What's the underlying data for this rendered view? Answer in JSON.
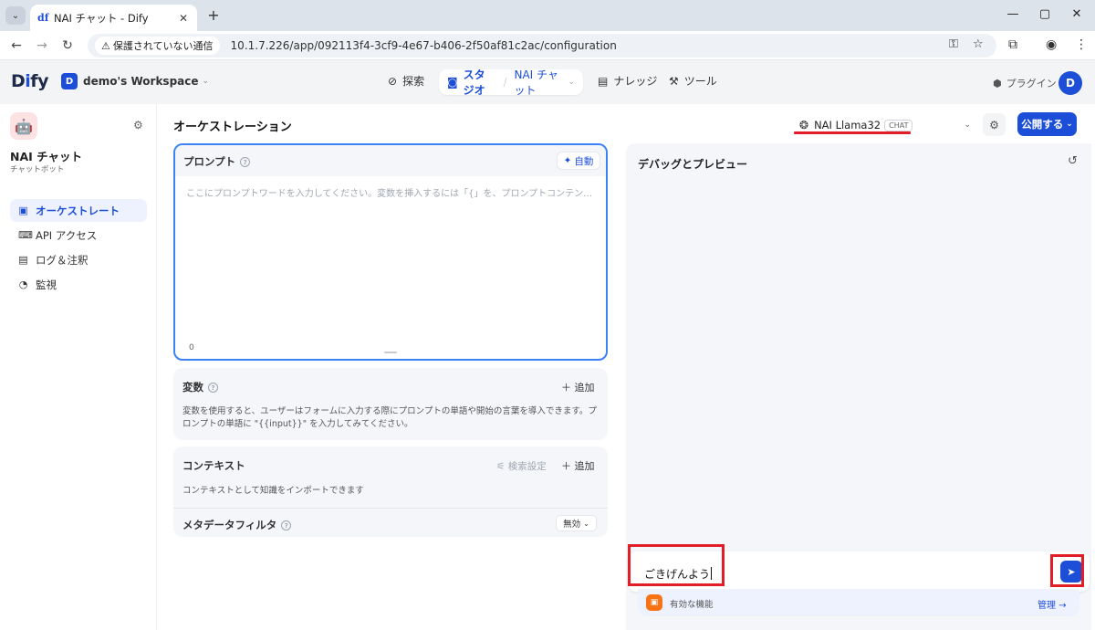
{
  "browser": {
    "tab_title": "NAI チャット - Dify",
    "tab_favicon": "df",
    "new_tab": "+",
    "security_label": "保護されていない通信",
    "url": "10.1.7.226/app/092113f4-3cf9-4e67-b406-2f50af81c2ac/configuration"
  },
  "header": {
    "logo_prefix": "D",
    "logo_i": "i",
    "logo_suffix": "fy",
    "workspace_initial": "D",
    "workspace_name": "demo's Workspace",
    "nav": {
      "explore": "探索",
      "studio": "スタジオ",
      "current_app": "NAI チャット",
      "knowledge": "ナレッジ",
      "tools": "ツール"
    },
    "plugins": "プラグイン",
    "user_initial": "D"
  },
  "sidebar": {
    "app_name": "NAI チャット",
    "app_type": "チャットボット",
    "items": [
      {
        "label": "オーケストレート"
      },
      {
        "label": "API アクセス"
      },
      {
        "label": "ログ＆注釈"
      },
      {
        "label": "監視"
      }
    ]
  },
  "orchestration": {
    "title": "オーケストレーション",
    "model_name": "NAI Llama32",
    "model_badge": "CHAT",
    "publish": "公開する",
    "prompt": {
      "label": "プロンプト",
      "auto": "自動",
      "placeholder": "ここにプロンプトワードを入力してください。変数を挿入するには「{」を、プロンプトコンテンツブロックを挿入するには「/」を入力します。",
      "count": "0"
    },
    "variables": {
      "title": "変数",
      "add": "追加",
      "desc": "変数を使用すると、ユーザーはフォームに入力する際にプロンプトの単語や開始の言葉を導入できます。プロンプトの単語に \"{{input}}\" を入力してみてください。"
    },
    "context": {
      "title": "コンテキスト",
      "retrieval_settings": "検索設定",
      "add": "追加",
      "desc": "コンテキストとして知識をインポートできます",
      "metadata_filter": "メタデータフィルタ",
      "filter_value": "無効"
    }
  },
  "debug": {
    "title": "デバッグとプレビュー",
    "input_value": "ごきげんよう",
    "features_label": "有効な機能",
    "manage": "管理"
  },
  "colors": {
    "accent": "#1d4ed8",
    "highlight": "#e11d27"
  }
}
